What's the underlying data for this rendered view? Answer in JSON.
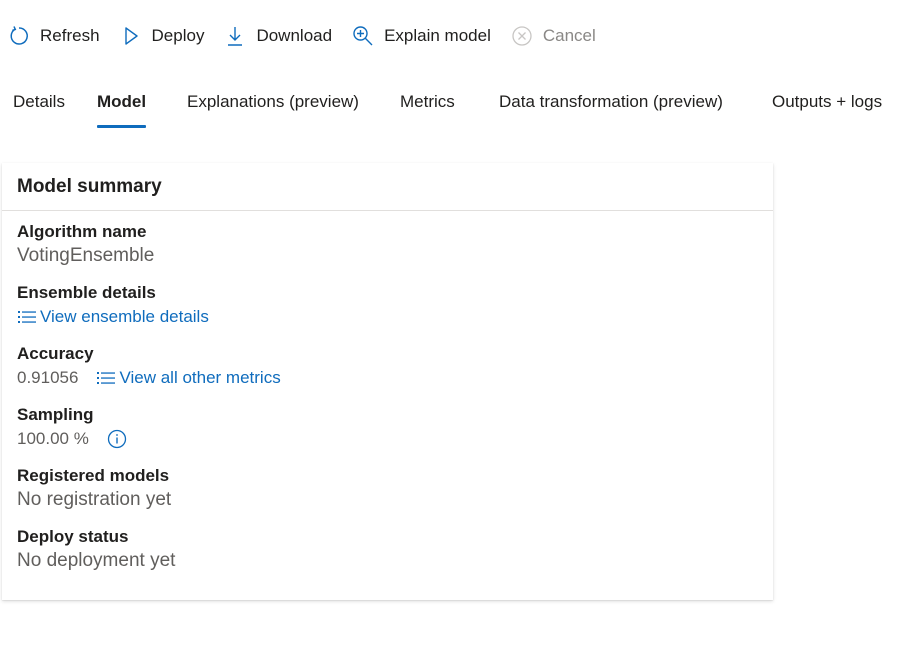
{
  "toolbar": {
    "refresh": "Refresh",
    "deploy": "Deploy",
    "download": "Download",
    "explain": "Explain model",
    "cancel": "Cancel"
  },
  "tabs": [
    {
      "label": "Details"
    },
    {
      "label": "Model",
      "active": true
    },
    {
      "label": "Explanations (preview)"
    },
    {
      "label": "Metrics"
    },
    {
      "label": "Data transformation (preview)"
    },
    {
      "label": "Outputs + logs"
    }
  ],
  "summary": {
    "title": "Model summary",
    "algorithm_label": "Algorithm name",
    "algorithm_value": "VotingEnsemble",
    "ensemble_label": "Ensemble details",
    "ensemble_link": "View ensemble details",
    "accuracy_label": "Accuracy",
    "accuracy_value": "0.91056",
    "metrics_link": "View all other metrics",
    "sampling_label": "Sampling",
    "sampling_value": "100.00 %",
    "registered_label": "Registered models",
    "registered_value": "No registration yet",
    "deploy_label": "Deploy status",
    "deploy_value": "No deployment yet"
  },
  "colors": {
    "accent": "#0f6cbd",
    "text": "#201f1e",
    "secondary_text": "#605e5c",
    "disabled": "#8a8886"
  }
}
